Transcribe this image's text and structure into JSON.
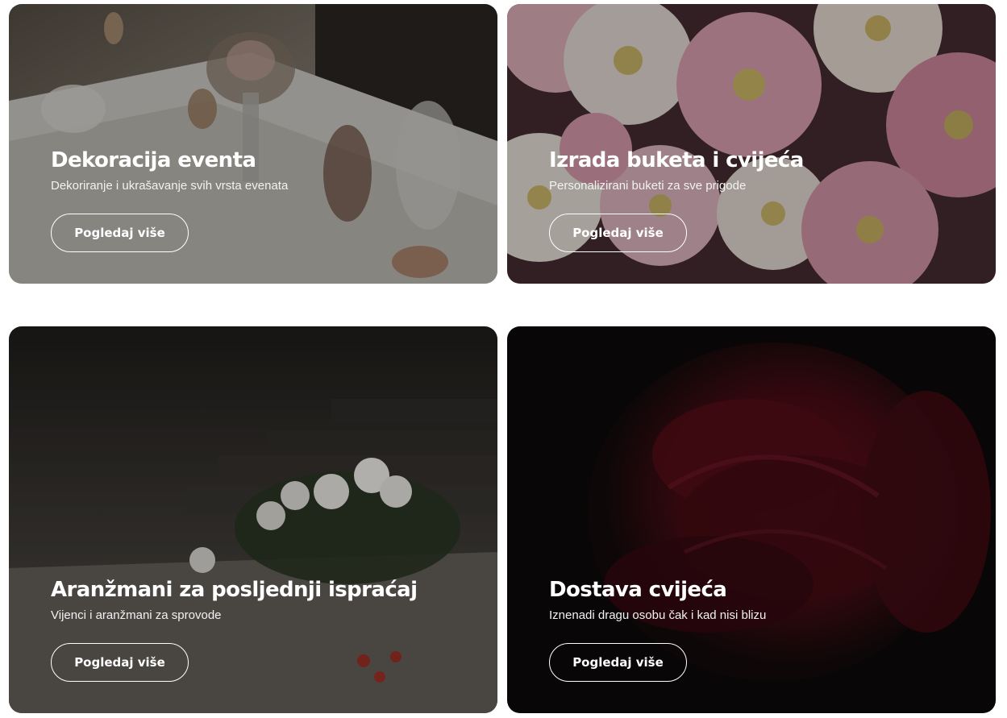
{
  "cards": [
    {
      "title": "Dekoracija eventa",
      "subtitle": "Dekoriranje i ukrašavanje svih vrsta evenata",
      "button_label": "Pogledaj više",
      "image": "event-table-decoration-photo"
    },
    {
      "title": "Izrada buketa i cvijeća",
      "subtitle": "Personalizirani buketi za sve prigode",
      "button_label": "Pogledaj više",
      "image": "pink-white-chrysanthemums-photo"
    },
    {
      "title": "Aranžmani za posljednji ispraćaj",
      "subtitle": "Vijenci i aranžmani za sprovode",
      "button_label": "Pogledaj više",
      "image": "flowers-on-grave-photo"
    },
    {
      "title": "Dostava cvijeća",
      "subtitle": "Iznenadi dragu osobu čak i kad nisi blizu",
      "button_label": "Pogledaj više",
      "image": "red-rose-dark-photo"
    }
  ]
}
